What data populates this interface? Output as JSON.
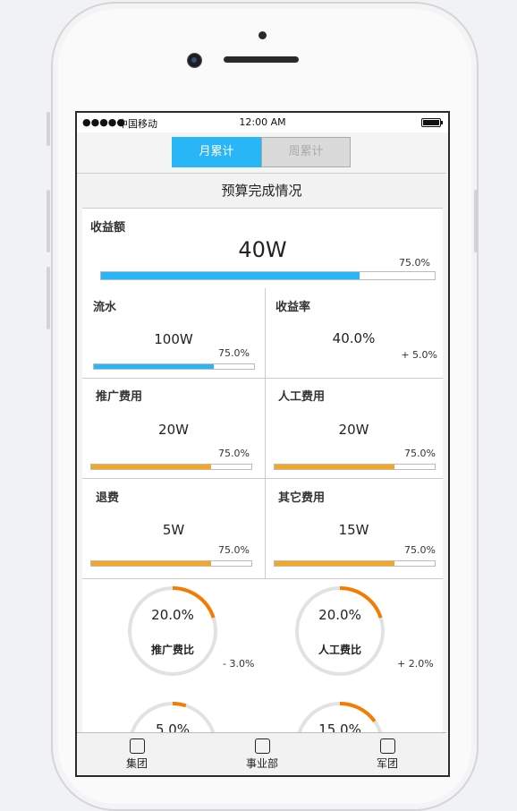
{
  "status_bar": {
    "carrier": "中国移动",
    "time": "12:00 AM",
    "signal": "●●●●●"
  },
  "tabs": [
    {
      "label": "月累计",
      "active": true
    },
    {
      "label": "周累计",
      "active": false
    }
  ],
  "section_title": "预算完成情况",
  "revenue": {
    "label": "收益额",
    "value": "40W",
    "percent_text": "75.0%",
    "progress": 0.776,
    "color": "#29b6f6"
  },
  "metrics": [
    {
      "label": "流水",
      "value": "100W",
      "percent_text": "75.0%",
      "progress": 0.75,
      "color": "#29b6f6"
    },
    {
      "label": "收益率",
      "value": "40.0%",
      "delta_text": "+ 5.0%"
    },
    {
      "label": "推广费用",
      "value": "20W",
      "percent_text": "75.0%",
      "progress": 0.75,
      "color": "#f5a623"
    },
    {
      "label": "人工费用",
      "value": "20W",
      "percent_text": "75.0%",
      "progress": 0.75,
      "color": "#f5a623"
    },
    {
      "label": "退费",
      "value": "5W",
      "percent_text": "75.0%",
      "progress": 0.75,
      "color": "#f5a623"
    },
    {
      "label": "其它费用",
      "value": "15W",
      "percent_text": "75.0%",
      "progress": 0.75,
      "color": "#f5a623"
    }
  ],
  "rings": [
    {
      "percent_text": "20.0%",
      "label": "推广费比",
      "delta_text": "-  3.0%",
      "fraction": 0.2
    },
    {
      "percent_text": "20.0%",
      "label": "人工费比",
      "delta_text": "+  2.0%",
      "fraction": 0.2
    },
    {
      "percent_text": "5.0%",
      "fraction": 0.05
    },
    {
      "percent_text": "15.0%",
      "fraction": 0.15
    }
  ],
  "ring_color": "#f57c00",
  "ring_track_color": "#e2e2e2",
  "bottom_nav": [
    {
      "label": "集团",
      "icon": "square-icon"
    },
    {
      "label": "事业部",
      "icon": "square-icon"
    },
    {
      "label": "军团",
      "icon": "square-icon"
    }
  ]
}
